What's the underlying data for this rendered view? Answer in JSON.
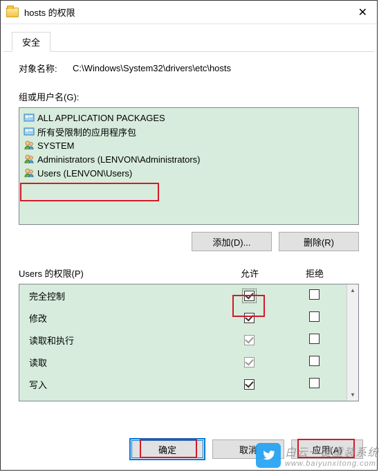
{
  "window": {
    "title": "hosts 的权限",
    "close_label": "✕"
  },
  "tab": {
    "label": "安全"
  },
  "object": {
    "label": "对象名称:",
    "path": "C:\\Windows\\System32\\drivers\\etc\\hosts"
  },
  "groups": {
    "label": "组或用户名(G):",
    "items": [
      {
        "icon": "package",
        "name": "ALL APPLICATION PACKAGES"
      },
      {
        "icon": "package",
        "name": "所有受限制的应用程序包"
      },
      {
        "icon": "user",
        "name": "SYSTEM"
      },
      {
        "icon": "group",
        "name": "Administrators (LENVON\\Administrators)"
      },
      {
        "icon": "group",
        "name": "Users (LENVON\\Users)"
      }
    ]
  },
  "buttons": {
    "add": "添加(D)...",
    "remove": "删除(R)",
    "ok": "确定",
    "cancel": "取消",
    "apply": "应用(A)"
  },
  "perm": {
    "header_left": "Users 的权限(P)",
    "header_allow": "允许",
    "header_deny": "拒绝",
    "rows": [
      {
        "label": "完全控制",
        "allow": true,
        "allow_focus": true,
        "deny": false
      },
      {
        "label": "修改",
        "allow": true,
        "deny": false
      },
      {
        "label": "读取和执行",
        "allow": true,
        "allow_grey": true,
        "deny": false
      },
      {
        "label": "读取",
        "allow": true,
        "allow_grey": true,
        "deny": false
      },
      {
        "label": "写入",
        "allow": true,
        "deny": false
      }
    ]
  },
  "watermark": {
    "text": "白云一键重装系统",
    "url": "www.baiyunxitong.com"
  }
}
